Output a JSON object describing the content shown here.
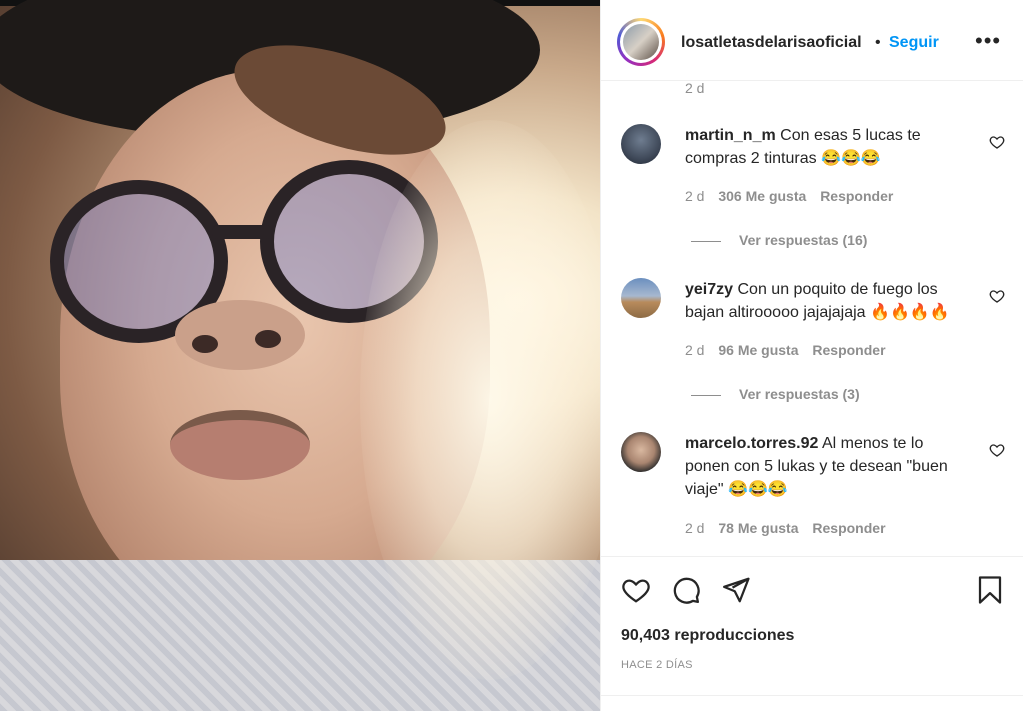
{
  "header": {
    "username": "losatletasdelarisaoficial",
    "separator": "•",
    "follow_label": "Seguir",
    "more_label": "•••"
  },
  "comments": {
    "previous_time": "2 d",
    "items": [
      {
        "user": "martin_n_m",
        "text": "Con esas 5 lucas te compras 2 tinturas 😂😂😂",
        "time": "2 d",
        "likes": "306 Me gusta",
        "reply_label": "Responder",
        "view_replies": "Ver respuestas (16)"
      },
      {
        "user": "yei7zy",
        "text": "Con un poquito de fuego los bajan altirooooo jajajajaja 🔥🔥🔥🔥",
        "time": "2 d",
        "likes": "96 Me gusta",
        "reply_label": "Responder",
        "view_replies": "Ver respuestas (3)"
      },
      {
        "user": "marcelo.torres.92",
        "text": "Al menos te lo ponen con 5 lukas y te desean \"buen viaje\" 😂😂😂",
        "time": "2 d",
        "likes": "78 Me gusta",
        "reply_label": "Responder"
      }
    ]
  },
  "footer": {
    "views": "90,403 reproducciones",
    "posted_ago": "HACE 2 DÍAS"
  },
  "icons": {
    "like": "heart-icon",
    "comment": "comment-icon",
    "share": "share-icon",
    "save": "bookmark-icon"
  }
}
